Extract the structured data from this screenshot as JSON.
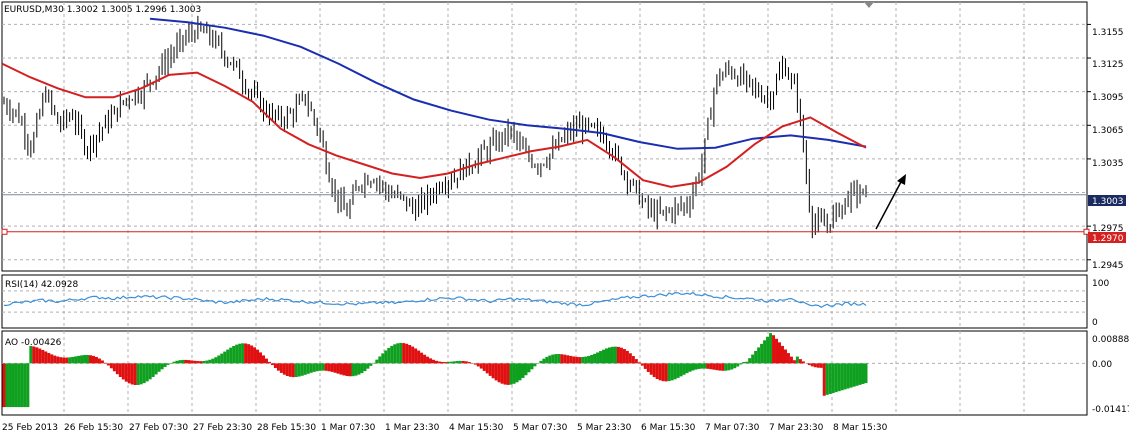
{
  "header": {
    "symbol_line": "EURUSD,M30  1.3002 1.3005 1.2996 1.3003"
  },
  "colors": {
    "grid": "#b0b0b0",
    "candle": "#000000",
    "ma_fast": "#d42020",
    "ma_slow": "#1a2fb0",
    "hline": "#d42020",
    "bid_line": "#7a8aa0",
    "rsi_line": "#3a8fd8",
    "ao_up": "#10a020",
    "ao_down": "#e01010",
    "current_label_bg": "#1b2a60",
    "level_label_bg": "#d42020"
  },
  "chart_data": [
    {
      "type": "candlestick",
      "title": "EURUSD,M30",
      "ohlc_current": {
        "open": 1.3002,
        "high": 1.3005,
        "low": 1.2996,
        "close": 1.3003
      },
      "ylim": [
        1.2935,
        1.3175
      ],
      "y_ticks": [
        "1.3155",
        "1.3125",
        "1.3095",
        "1.3065",
        "1.3035",
        "1.2975",
        "1.2945"
      ],
      "current_price_label": "1.3003",
      "horizontal_level_label": "1.2970",
      "horizontal_level": 1.297,
      "x_tick_labels": [
        "25 Feb 2013",
        "26 Feb 15:30",
        "27 Feb 07:30",
        "27 Feb 23:30",
        "28 Feb 15:30",
        "1 Mar 07:30",
        "1 Mar 23:30",
        "4 Mar 15:30",
        "5 Mar 07:30",
        "5 Mar 23:30",
        "6 Mar 15:30",
        "7 Mar 07:30",
        "7 Mar 23:30",
        "8 Mar 15:30"
      ],
      "close_path": [
        1.3085,
        1.3075,
        1.3045,
        1.3095,
        1.3065,
        1.3075,
        1.3045,
        1.306,
        1.3075,
        1.309,
        1.3095,
        1.311,
        1.3125,
        1.314,
        1.315,
        1.3145,
        1.313,
        1.3115,
        1.3095,
        1.308,
        1.307,
        1.3075,
        1.309,
        1.306,
        1.301,
        1.2985,
        1.3015,
        1.302,
        1.3005,
        1.3,
        1.299,
        1.3,
        1.3015,
        1.302,
        1.303,
        1.304,
        1.305,
        1.306,
        1.304,
        1.303,
        1.304,
        1.3055,
        1.3065,
        1.306,
        1.3055,
        1.303,
        1.301,
        1.299,
        1.2985,
        1.299,
        1.2995,
        1.303,
        1.3105,
        1.3115,
        1.3105,
        1.3095,
        1.309,
        1.312,
        1.309,
        1.298,
        1.2975,
        1.299,
        1.3005,
        1.3003
      ],
      "ma_fast": [
        1.312,
        1.3108,
        1.3098,
        1.309,
        1.309,
        1.3098,
        1.311,
        1.3112,
        1.31,
        1.3086,
        1.3062,
        1.3048,
        1.3038,
        1.303,
        1.3022,
        1.3018,
        1.3022,
        1.303,
        1.3036,
        1.3042,
        1.3046,
        1.3052,
        1.3036,
        1.3016,
        1.301,
        1.3014,
        1.3028,
        1.3048,
        1.3064,
        1.3072,
        1.3058,
        1.3045
      ],
      "ma_slow": [
        1.316,
        1.3157,
        1.3152,
        1.3145,
        1.3135,
        1.312,
        1.3103,
        1.3088,
        1.3078,
        1.307,
        1.3065,
        1.3062,
        1.3058,
        1.305,
        1.3044,
        1.3045,
        1.3053,
        1.3056,
        1.3052,
        1.3046
      ]
    },
    {
      "type": "line",
      "title": "RSI(14) 42.0928",
      "ylim": [
        0,
        100
      ],
      "y_ticks": [
        "100",
        "0"
      ],
      "values": [
        45,
        48,
        52,
        50,
        55,
        58,
        56,
        60,
        58,
        57,
        55,
        50,
        48,
        52,
        55,
        53,
        50,
        48,
        46,
        45,
        48,
        47,
        52,
        55,
        57,
        54,
        50,
        55,
        53,
        50,
        46,
        44,
        50,
        56,
        60,
        62,
        66,
        64,
        60,
        57,
        55,
        50,
        58,
        40,
        43,
        46,
        45
      ]
    },
    {
      "type": "bar",
      "title": "AO -0.00426",
      "ylim": [
        -0.01417,
        0.00888
      ],
      "y_ticks": [
        "0.00888",
        "0.00",
        "-0.01417"
      ]
    }
  ]
}
